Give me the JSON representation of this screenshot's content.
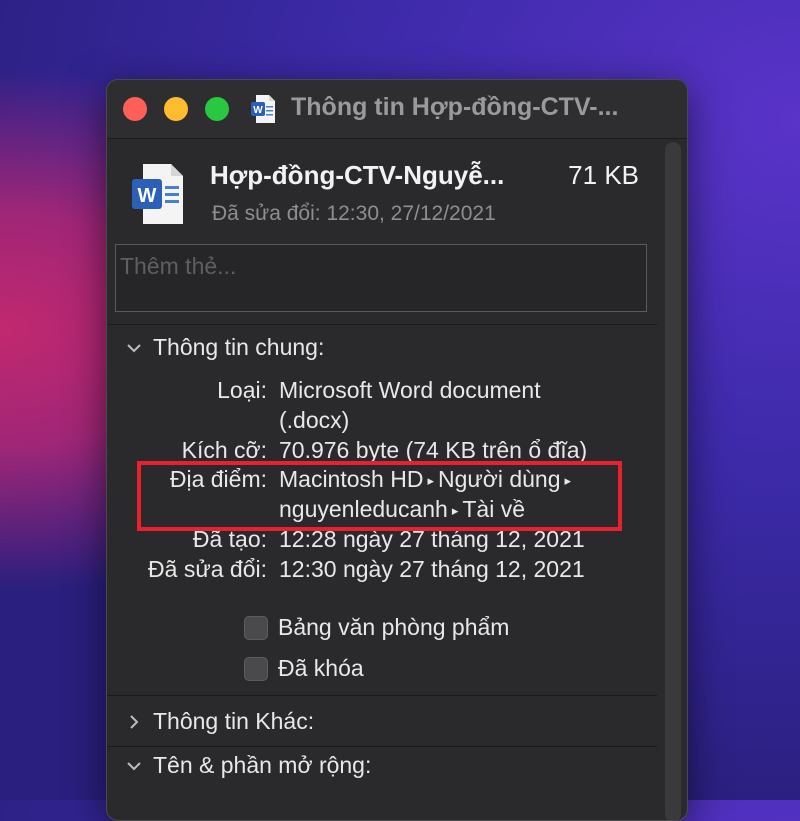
{
  "window": {
    "title": "Thông tin Hợp-đồng-CTV-...",
    "file_icon": "word-doc-icon"
  },
  "header": {
    "file_name": "Hợp-đồng-CTV-Nguyễ...",
    "file_size": "71 KB",
    "modified": "Đã sửa đổi: 12:30, 27/12/2021"
  },
  "tags": {
    "placeholder": "Thêm thẻ..."
  },
  "general": {
    "heading": "Thông tin chung:",
    "kind_label": "Loại:",
    "kind_value_1": "Microsoft Word document",
    "kind_value_2": "(.docx)",
    "size_label": "Kích cỡ:",
    "size_value": "70.976 byte (74 KB trên ổ đĩa)",
    "where_label": "Địa điểm:",
    "where_seg1": "Macintosh HD",
    "where_seg2": "Người dùng",
    "where_seg3": "nguyenleducanh",
    "where_seg4": "Tài về",
    "created_label": "Đã tạo:",
    "created_value": "12:28 ngày 27 tháng 12, 2021",
    "modified_label": "Đã sửa đổi:",
    "modified_value": "12:30 ngày 27 tháng 12, 2021",
    "stationery_label": "Bảng văn phòng phẩm",
    "locked_label": "Đã khóa"
  },
  "more_info": {
    "heading": "Thông tin Khác:"
  },
  "name_ext": {
    "heading": "Tên & phần mở rộng:"
  },
  "colors": {
    "highlight": "#e8202f",
    "window_bg": "#2a2a2c"
  }
}
